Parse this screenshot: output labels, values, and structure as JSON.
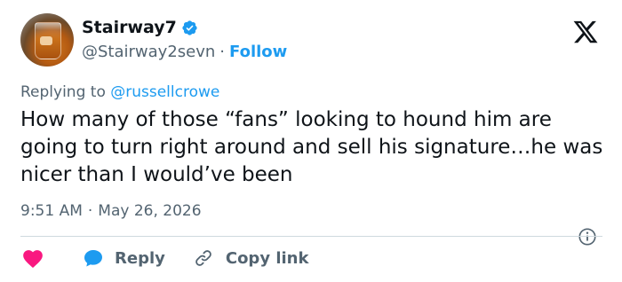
{
  "author": {
    "name": "Stairway7",
    "handle": "@Stairway2sevn",
    "separator": "·",
    "follow_label": "Follow",
    "verified_icon": "verified-badge-icon",
    "verified_color": "#1d9bf0"
  },
  "platform_logo": "x-logo-icon",
  "reply_context": {
    "prefix": "Replying to",
    "mention": "@russellcrowe"
  },
  "tweet": {
    "text": "How many of those “fans” looking to hound him are going to turn right around and sell his signature…he was nicer than I would’ve been"
  },
  "meta": {
    "time": "9:51 AM",
    "separator": "·",
    "date": "May 26, 2026",
    "info_icon": "info-icon"
  },
  "actions": {
    "like_icon": "heart-icon",
    "like_color": "#f91880",
    "reply_icon": "reply-bubble-icon",
    "reply_color": "#1d9bf0",
    "reply_label": "Reply",
    "copy_icon": "link-icon",
    "copy_label": "Copy link"
  },
  "colors": {
    "accent": "#1d9bf0",
    "text": "#0f1419",
    "muted": "#536471",
    "divider": "#cfd9de"
  }
}
